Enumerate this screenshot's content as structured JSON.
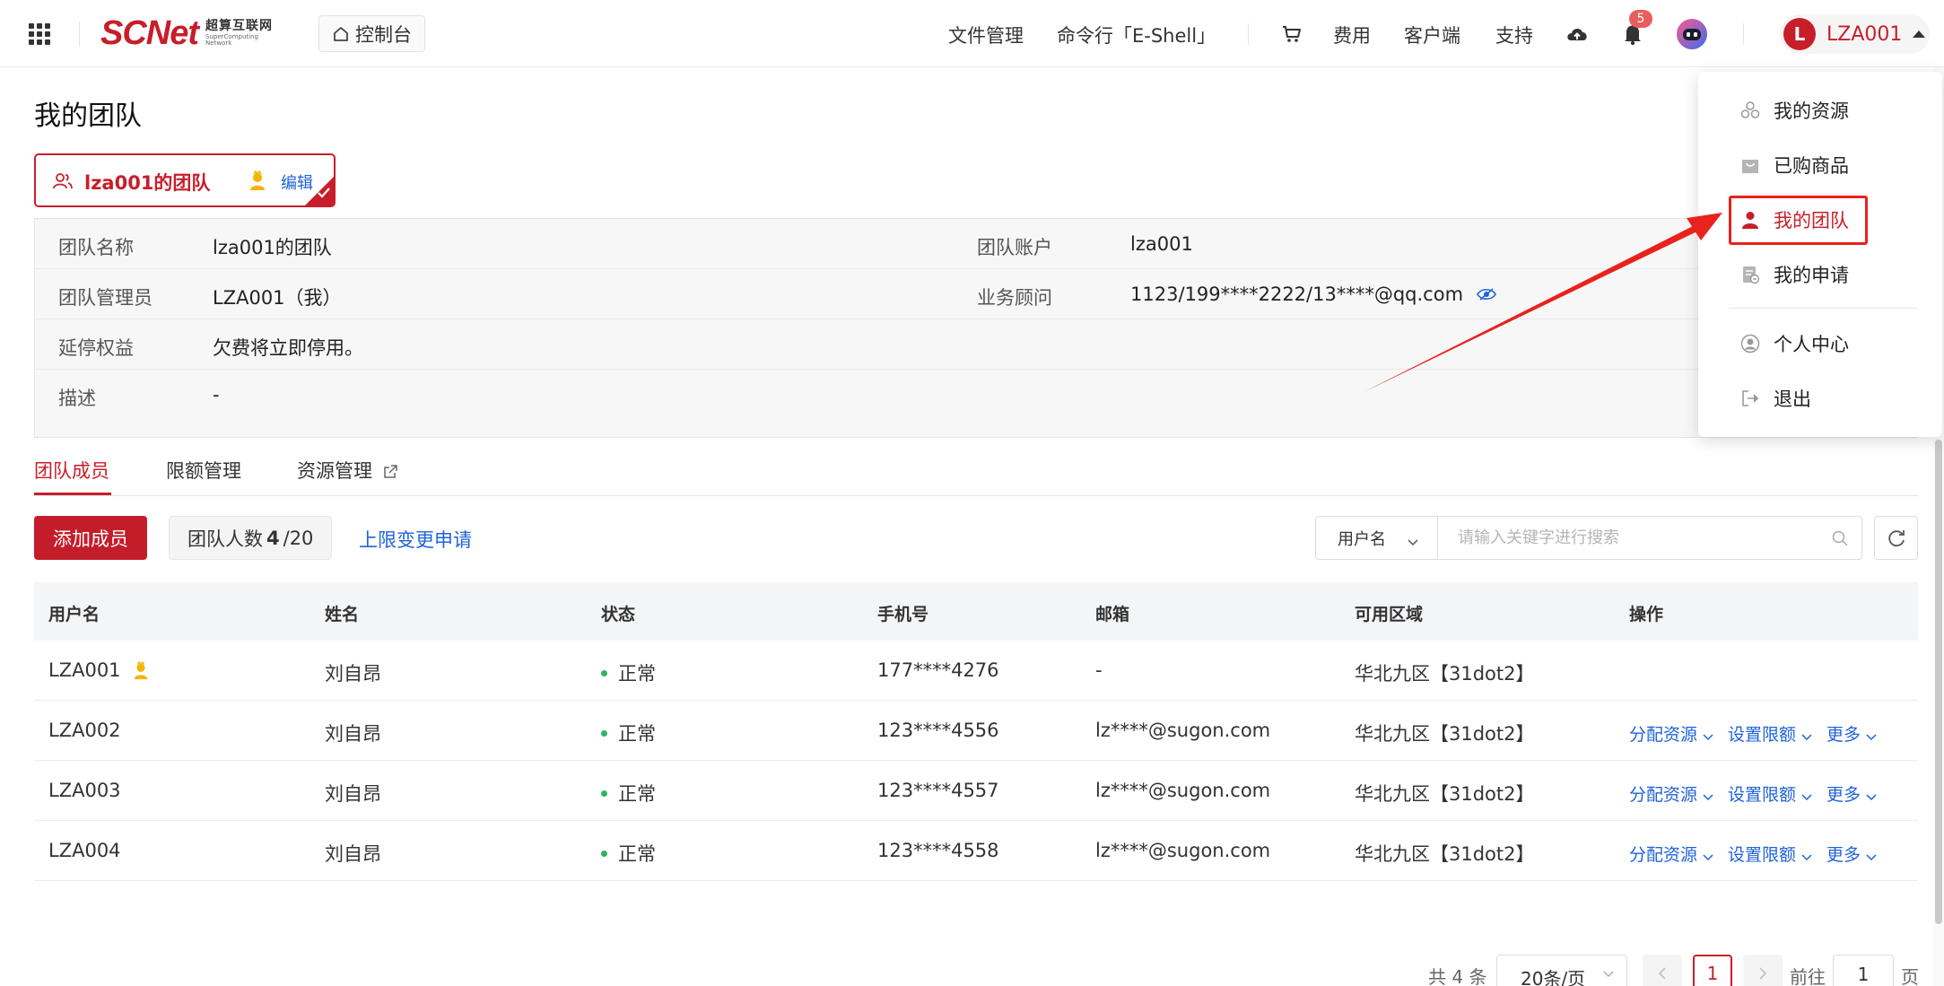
{
  "header": {
    "logo_main": "SCNet",
    "logo_cn": "超算互联网",
    "logo_en": "SuperComputing Network",
    "console_label": "控制台",
    "nav": [
      "文件管理",
      "命令行「E-Shell」",
      "费用",
      "客户端",
      "支持"
    ],
    "notification_count": "5",
    "user_initial": "L",
    "user_name": "LZA001"
  },
  "page": {
    "title": "我的团队"
  },
  "team_card": {
    "name": "lza001的团队",
    "edit_label": "编辑"
  },
  "info": {
    "team_name_label": "团队名称",
    "team_name": "lza001的团队",
    "team_account_label": "团队账户",
    "team_account": "lza001",
    "admin_label": "团队管理员",
    "admin": "LZA001（我）",
    "advisor_label": "业务顾问",
    "advisor": "1123/199****2222/13****@qq.com",
    "benefit_label": "延停权益",
    "benefit": "欠费将立即停用。",
    "desc_label": "描述",
    "desc": "-"
  },
  "tabs": {
    "members": "团队成员",
    "quota": "限额管理",
    "resources": "资源管理"
  },
  "toolbar": {
    "add_label": "添加成员",
    "count_prefix": "团队人数",
    "count_current": "4",
    "count_max": "/20",
    "apply_link": "上限变更申请",
    "search_field": "用户名",
    "search_placeholder": "请输入关键字进行搜索"
  },
  "table": {
    "columns": [
      "用户名",
      "姓名",
      "状态",
      "手机号",
      "邮箱",
      "可用区域",
      "操作"
    ],
    "rows": [
      {
        "username": "LZA001",
        "name": "刘自昂",
        "status": "正常",
        "phone": "177****4276",
        "email": "-",
        "region": "华北九区【31dot2】"
      },
      {
        "username": "LZA002",
        "name": "刘自昂",
        "status": "正常",
        "phone": "123****4556",
        "email": "lz****@sugon.com",
        "region": "华北九区【31dot2】"
      },
      {
        "username": "LZA003",
        "name": "刘自昂",
        "status": "正常",
        "phone": "123****4557",
        "email": "lz****@sugon.com",
        "region": "华北九区【31dot2】"
      },
      {
        "username": "LZA004",
        "name": "刘自昂",
        "status": "正常",
        "phone": "123****4558",
        "email": "lz****@sugon.com",
        "region": "华北九区【31dot2】"
      }
    ],
    "ops": {
      "assign": "分配资源",
      "set_quota": "设置限额",
      "more": "更多"
    }
  },
  "pagination": {
    "total": "共 4 条",
    "page_size": "20条/页",
    "current_page": "1",
    "goto_prefix": "前往",
    "goto_value": "1",
    "goto_suffix": "页"
  },
  "dropdown": {
    "items": [
      "我的资源",
      "已购商品",
      "我的团队",
      "我的申请",
      "个人中心",
      "退出"
    ]
  },
  "colors": {
    "brand_red": "#c81e2a",
    "link_blue": "#1f63d8",
    "status_green": "#2db55d",
    "annotation_red": "#e8221c"
  }
}
